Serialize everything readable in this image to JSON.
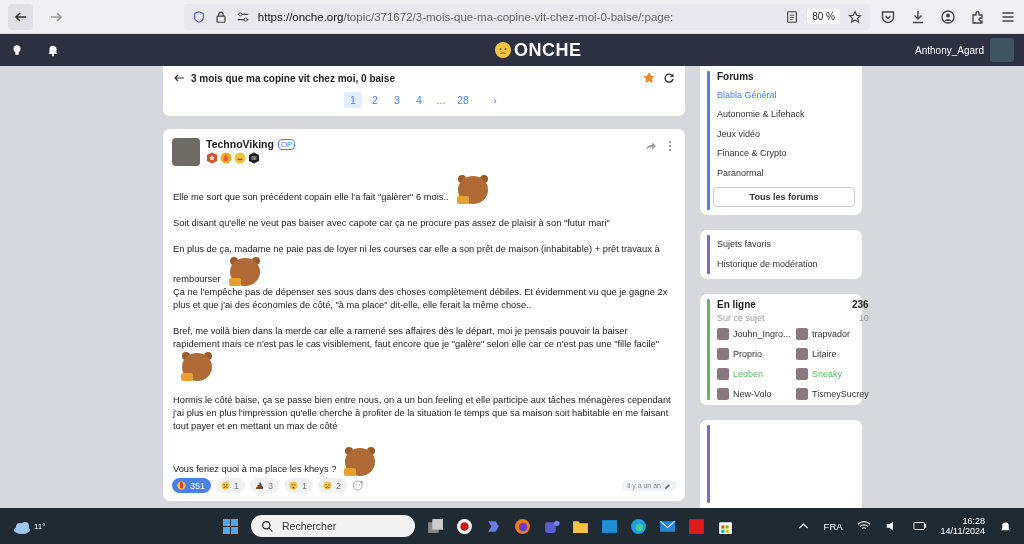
{
  "browser": {
    "url_host": "https://onche.org",
    "url_path": "/topic/371672/3-mois-que-ma-copine-vit-chez-moi-0-baise/:page:",
    "zoom": "80 %"
  },
  "header": {
    "logo": "ONCHE",
    "username": "Anthony_Agard"
  },
  "topic": {
    "title": "3 mois que ma copine vit chez moi, 0 baise",
    "favorite": true,
    "pages": [
      {
        "label": "1",
        "selected": true
      },
      {
        "label": "2",
        "selected": false
      },
      {
        "label": "3",
        "selected": false
      },
      {
        "label": "4",
        "selected": false
      },
      {
        "label": "...",
        "selected": false
      },
      {
        "label": "28",
        "selected": false
      }
    ],
    "next": "›"
  },
  "post": {
    "author": "TechnoViking",
    "op_badge": "OP",
    "time": "il y a un an",
    "paragraphs": [
      {
        "text": "Elle me sort que son précédent copain elle l'a fait \"galèrer\" 6 mois..",
        "sticker": true,
        "spaced": true
      },
      {
        "text": "Soit disant qu'elle ne veut pas baiser avec capote car ça ne procure pas assez de plaisir à son \"futur mari\"",
        "sticker": false,
        "spaced": true
      },
      {
        "text": "En plus de ça, madame ne paie pas de loyer ni les courses car elle a son prêt de maison (inhabitable) + prêt travaux à rembourser",
        "sticker": true,
        "spaced": false
      },
      {
        "text": "Ça ne l'empêche pas de dépenser ses sous dans des choses complètement débiles. Et évidemment vu que je gagne 2x plus et que j'ai des économies de côté, \"à ma place\" dit-elle, elle ferait la même chose..",
        "sticker": false,
        "spaced": true
      },
      {
        "text": "Bref, me voilà bien dans la merde car elle a ramené ses affaires dès le départ, moi je pensais pouvoir la baiser rapidement mais ce n'est pas le cas visiblement, faut encore que je \"galère\" selon elle car ce n'est pas une \"fille facile\"",
        "sticker": true,
        "spaced": true
      },
      {
        "text": "Hormis le côté baise, ça se passe bien entre nous, on a un bon feeling et elle participe aux tâches ménagères cependant j'ai plus en plus l'impression qu'elle cherche à profiter de la situation le temps que sa maison soit habitable en me faisant tout payer et en mettant un max de côté",
        "sticker": false,
        "spaced": true
      },
      {
        "text": "Vous feriez quoi à ma place les kheys ?",
        "sticker": true,
        "spaced": false
      }
    ],
    "reactions": [
      {
        "kind": "fire",
        "count": "351",
        "selected": true
      },
      {
        "kind": "cry",
        "count": "1",
        "selected": false
      },
      {
        "kind": "poop",
        "count": "3",
        "selected": false
      },
      {
        "kind": "shock",
        "count": "1",
        "selected": false
      },
      {
        "kind": "sad",
        "count": "2",
        "selected": false
      }
    ]
  },
  "sidebar": {
    "forums": {
      "title": "Forums",
      "items": [
        {
          "label": "Blabla Général",
          "selected": true
        },
        {
          "label": "Autonomie & Lifehack",
          "selected": false
        },
        {
          "label": "Jeux vidéo",
          "selected": false
        },
        {
          "label": "Finance & Crypto",
          "selected": false
        },
        {
          "label": "Paranormal",
          "selected": false
        }
      ],
      "button": "Tous les forums"
    },
    "links": [
      "Sujets favoris",
      "Historique de modération"
    ],
    "online": {
      "title": "En ligne",
      "count": "236",
      "subtitle": "Sur ce sujet",
      "subcount": "10",
      "users": [
        {
          "name": "Jouhn_Ingro...",
          "highlighted": false
        },
        {
          "name": "trapvador",
          "highlighted": false
        },
        {
          "name": "Proprio",
          "highlighted": false
        },
        {
          "name": "Litaire",
          "highlighted": false
        },
        {
          "name": "Leoben",
          "highlighted": true
        },
        {
          "name": "Sneaky",
          "highlighted": true
        },
        {
          "name": "New-Volo",
          "highlighted": false
        },
        {
          "name": "TismeySucrey",
          "highlighted": false
        }
      ]
    }
  },
  "taskbar": {
    "weather": "11°",
    "search_placeholder": "Rechercher",
    "language": "FRA",
    "time": "16:28",
    "date": "14/11/2024"
  }
}
